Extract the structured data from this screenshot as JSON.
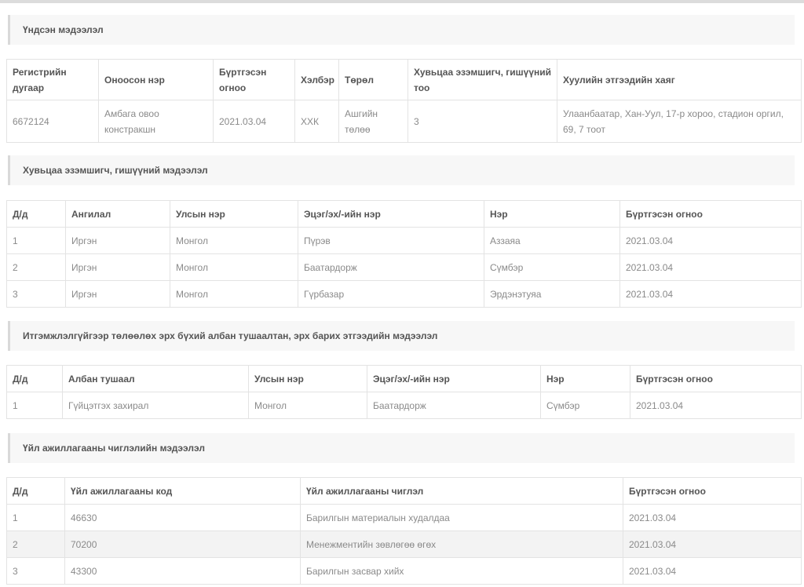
{
  "basic": {
    "heading": "Үндсэн мэдээлэл",
    "headers": [
      "Регистрийн дугаар",
      "Оноосон нэр",
      "Бүртгэсэн огноо",
      "Хэлбэр",
      "Төрөл",
      "Хувьцаа эзэмшигч, гишүүний тоо",
      "Хуулийн этгээдийн хаяг"
    ],
    "row": [
      "6672124",
      "Амбага овоо констракшн",
      "2021.03.04",
      "ХХК",
      "Ашгийн төлөө",
      "3",
      "Улаанбаатар, Хан-Уул, 17-р хороо, стадион оргил, 69, 7 тоот"
    ]
  },
  "shareholders": {
    "heading": "Хувьцаа эзэмшигч, гишүүний мэдээлэл",
    "headers": [
      "Д/д",
      "Ангилал",
      "Улсын нэр",
      "Эцэг/эх/-ийн нэр",
      "Нэр",
      "Бүртгэсэн огноо"
    ],
    "rows": [
      [
        "1",
        "Иргэн",
        "Монгол",
        "Пүрэв",
        "Аззаяа",
        "2021.03.04"
      ],
      [
        "2",
        "Иргэн",
        "Монгол",
        "Баатардорж",
        "Сүмбэр",
        "2021.03.04"
      ],
      [
        "3",
        "Иргэн",
        "Монгол",
        "Гүрбазар",
        "Эрдэнэтуяа",
        "2021.03.04"
      ]
    ]
  },
  "officials": {
    "heading": "Итгэмжлэлгүйгээр төлөөлөх эрх бүхий албан тушаалтан, эрх барих этгээдийн мэдээлэл",
    "headers": [
      "Д/д",
      "Албан тушаал",
      "Улсын нэр",
      "Эцэг/эх/-ийн нэр",
      "Нэр",
      "Бүртгэсэн огноо"
    ],
    "rows": [
      [
        "1",
        "Гүйцэтгэх захирал",
        "Монгол",
        "Баатардорж",
        "Сүмбэр",
        "2021.03.04"
      ]
    ]
  },
  "activities": {
    "heading": "Үйл ажиллагааны чиглэлийн мэдээлэл",
    "headers": [
      "Д/д",
      "Үйл ажиллагааны код",
      "Үйл ажиллагааны чиглэл",
      "Бүртгэсэн огноо"
    ],
    "rows": [
      [
        "1",
        "46630",
        "Барилгын материалын худалдаа",
        "2021.03.04"
      ],
      [
        "2",
        "70200",
        "Менежментийн зөвлөгөө өгөх",
        "2021.03.04"
      ],
      [
        "3",
        "43300",
        "Барилгын засвар хийх",
        "2021.03.04"
      ]
    ]
  }
}
